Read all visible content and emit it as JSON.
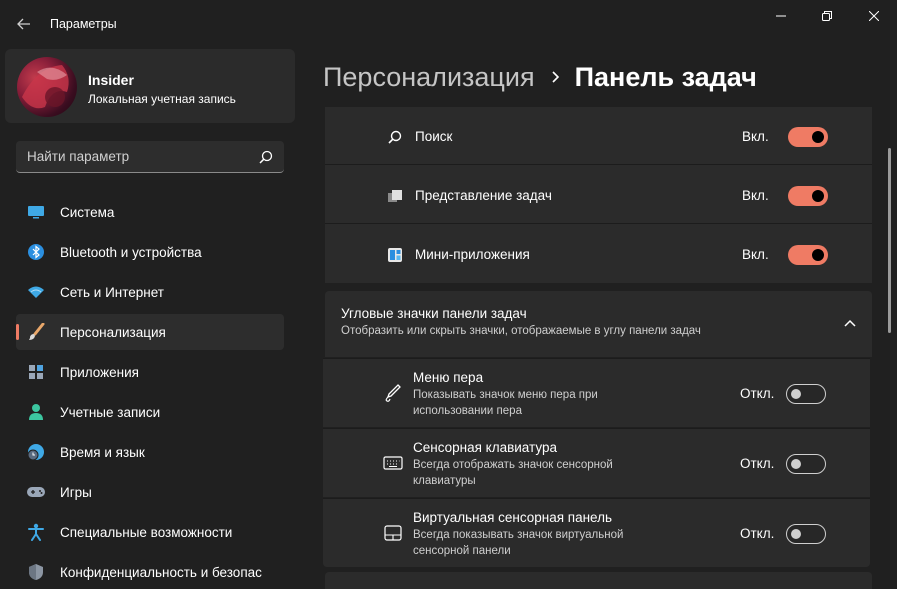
{
  "window": {
    "title": "Параметры",
    "minimize_icon": "minimize-icon",
    "maximize_icon": "restore-icon",
    "close_icon": "close-icon"
  },
  "profile": {
    "name": "Insider",
    "account_type": "Локальная учетная запись"
  },
  "search": {
    "placeholder": "Найти параметр"
  },
  "sidebar": {
    "items": [
      {
        "label": "Система",
        "icon": "monitor-icon",
        "active": false
      },
      {
        "label": "Bluetooth и устройства",
        "icon": "bluetooth-icon",
        "active": false
      },
      {
        "label": "Сеть и Интернет",
        "icon": "wifi-icon",
        "active": false
      },
      {
        "label": "Персонализация",
        "icon": "brush-icon",
        "active": true
      },
      {
        "label": "Приложения",
        "icon": "apps-icon",
        "active": false
      },
      {
        "label": "Учетные записи",
        "icon": "person-icon",
        "active": false
      },
      {
        "label": "Время и язык",
        "icon": "clock-globe-icon",
        "active": false
      },
      {
        "label": "Игры",
        "icon": "gamepad-icon",
        "active": false
      },
      {
        "label": "Специальные возможности",
        "icon": "accessibility-icon",
        "active": false
      },
      {
        "label": "Конфиденциальность и безопас",
        "icon": "shield-icon",
        "active": false
      }
    ]
  },
  "breadcrumb": {
    "parent": "Персонализация",
    "current": "Панель задач"
  },
  "taskbar_items": [
    {
      "title": "Поиск",
      "icon": "search-icon",
      "state": "Вкл.",
      "on": true
    },
    {
      "title": "Представление задач",
      "icon": "task-view-icon",
      "state": "Вкл.",
      "on": true
    },
    {
      "title": "Мини-приложения",
      "icon": "widgets-icon",
      "state": "Вкл.",
      "on": true
    }
  ],
  "corner_section": {
    "title": "Угловые значки панели задач",
    "subtitle": "Отобразить или скрыть значки, отображаемые в углу панели задач",
    "items": [
      {
        "title": "Меню пера",
        "desc_line1": "Показывать значок меню пера при",
        "desc_line2": "использовании пера",
        "icon": "pen-icon",
        "state": "Откл.",
        "on": false
      },
      {
        "title": "Сенсорная клавиатура",
        "desc_line1": "Всегда отображать значок сенсорной",
        "desc_line2": "клавиатуры",
        "icon": "keyboard-icon",
        "state": "Откл.",
        "on": false
      },
      {
        "title": "Виртуальная сенсорная панель",
        "desc_line1": "Всегда показывать значок виртуальной",
        "desc_line2": "сенсорной панели",
        "icon": "touchpad-icon",
        "state": "Откл.",
        "on": false
      }
    ]
  },
  "colors": {
    "accent": "#ef7b64",
    "background": "#202020",
    "card": "#2b2b2b"
  }
}
